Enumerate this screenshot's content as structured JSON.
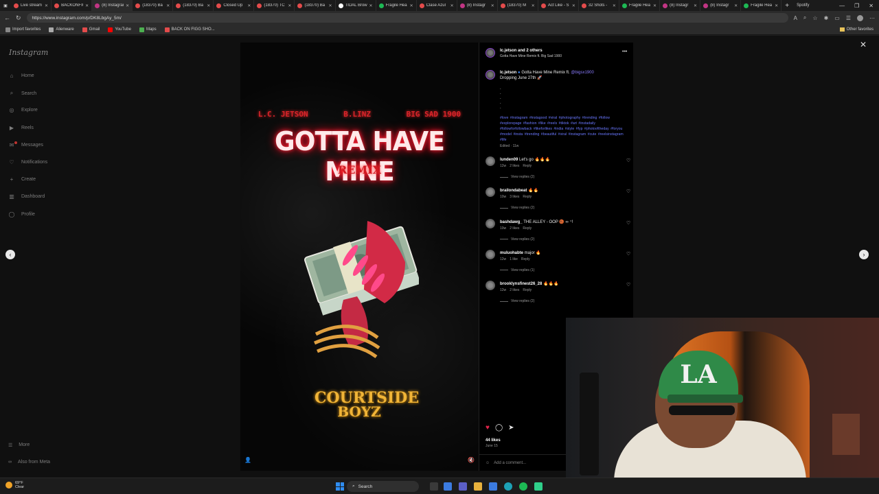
{
  "browser": {
    "tabs": [
      {
        "title": "Live stream",
        "color": "#e34b4b"
      },
      {
        "title": "BACKONFIG",
        "color": "#e34b4b"
      },
      {
        "title": "(8) Instagram",
        "color": "#c13584",
        "active": true
      },
      {
        "title": "(18370) Ba",
        "color": "#e34b4b"
      },
      {
        "title": "(18370) Ba",
        "color": "#e34b4b"
      },
      {
        "title": "Closed Up",
        "color": "#e34b4b"
      },
      {
        "title": "(18370) TC",
        "color": "#e34b4b"
      },
      {
        "title": "(18370) Ba",
        "color": "#e34b4b"
      },
      {
        "title": "TIDAL Brow",
        "color": "#ffffff"
      },
      {
        "title": "Fragile Hea",
        "color": "#1db954"
      },
      {
        "title": "Clase Azul",
        "color": "#e34b4b"
      },
      {
        "title": "(8) Instagr",
        "color": "#c13584"
      },
      {
        "title": "(18370) M",
        "color": "#e34b4b"
      },
      {
        "title": "Act Like - S",
        "color": "#e34b4b"
      },
      {
        "title": "32 Shots -",
        "color": "#e34b4b"
      },
      {
        "title": "Fragile Hea",
        "color": "#1db954"
      },
      {
        "title": "(8) Instagr",
        "color": "#c13584"
      },
      {
        "title": "(8) Instagr",
        "color": "#c13584"
      },
      {
        "title": "Fragile Hea",
        "color": "#1db954"
      }
    ],
    "new_tab": "+",
    "spotify_label": "Spotify",
    "url": "https://www.instagram.com/p/DK8LbgAy_5m/",
    "bookmarks": [
      {
        "label": "Import favorites",
        "color": "#888888"
      },
      {
        "label": "Alienware",
        "color": "#aaaaaa"
      },
      {
        "label": "Gmail",
        "color": "#e34b4b"
      },
      {
        "label": "YouTube",
        "color": "#ff0000"
      },
      {
        "label": "Maps",
        "color": "#4caf50"
      },
      {
        "label": "BACK ON FIGG SHO...",
        "color": "#e34b4b"
      }
    ],
    "other_favorites": "Other favorites"
  },
  "sidebar": {
    "logo": "Instagram",
    "items": [
      {
        "label": "Home",
        "icon": "⌂"
      },
      {
        "label": "Search",
        "icon": "⌕"
      },
      {
        "label": "Explore",
        "icon": "◎"
      },
      {
        "label": "Reels",
        "icon": "▶"
      },
      {
        "label": "Messages",
        "icon": "✉"
      },
      {
        "label": "Notifications",
        "icon": "♡"
      },
      {
        "label": "Create",
        "icon": "+"
      },
      {
        "label": "Dashboard",
        "icon": "▥"
      },
      {
        "label": "Profile",
        "icon": "◯"
      }
    ],
    "more": "More",
    "also_from_meta": "Also from Meta"
  },
  "media": {
    "artists": [
      "L.C. JETSON",
      "B.LINZ",
      "BIG SAD 1900"
    ],
    "title": "GOTTA HAVE MINE",
    "subtitle": "REMIX",
    "brand_line1": "COURTSIDE",
    "brand_line2": "BOYZ"
  },
  "post": {
    "header_user": "lc.jetson and 2 others",
    "header_sub": "Gotta Have Mine Remix ft. Big Sad 1900",
    "caption_user": "lc.jetson",
    "caption_text": "Gotta Have Mine Remix ft.",
    "caption_mention": "@bigsx1900",
    "caption_line2": "Dropping June 27th 🚀",
    "caption_dots": ".\n.\n.\n.\n.",
    "hashtags": "#love #instagram #instagood #viral #photography #trending #follow #explorepage #fashion #like #reels #tiktok #art #instadaily #followforfollowback #likeforlikes #india #style #fyp #photooftheday #foryou #model #insta #trending #beautiful #viral #instagram #cute #reelsinstagram #life",
    "edited": "Edited · 11w",
    "comments": [
      {
        "user": "lunden09",
        "text": "Let's go 🔥🔥🔥",
        "age": "12w",
        "likes": "2 likes",
        "reply": "Reply",
        "replies": "View replies (2)"
      },
      {
        "user": "brailondabeat",
        "text": "🔥🔥",
        "age": "10w",
        "likes": "3 likes",
        "reply": "Reply",
        "replies": "View replies (2)"
      },
      {
        "user": "bashdawg_",
        "text": "THE ALLEY - OOP 🏀 ∞ ⁺!",
        "age": "10w",
        "likes": "2 likes",
        "reply": "Reply",
        "replies": "View replies (2)"
      },
      {
        "user": "muluohabte",
        "text": "major 🔥",
        "age": "12w",
        "likes": "1 like",
        "reply": "Reply",
        "replies": "View replies (1)"
      },
      {
        "user": "brooklynsfinest26_28",
        "text": "🔥🔥🔥",
        "age": "12w",
        "likes": "2 likes",
        "reply": "Reply",
        "replies": "View replies (2)"
      }
    ],
    "likes": "44 likes",
    "date": "June 15",
    "add_comment_placeholder": "Add a comment..."
  },
  "webcam": {
    "cap_text": "LA"
  },
  "taskbar": {
    "weather_temp": "69°F",
    "weather_cond": "Clear",
    "search_label": "Search"
  },
  "colors": {
    "instagram_like": "#e1244a",
    "hashtag_link": "#6a78ff",
    "title_glow": "#ff2a3a"
  }
}
